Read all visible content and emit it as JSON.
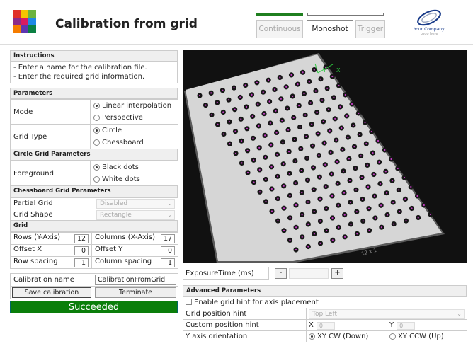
{
  "header": {
    "title": "Calibration from grid",
    "modes": [
      "Continuous",
      "Monoshot",
      "Trigger"
    ],
    "active_mode": "Monoshot",
    "company_line1": "Your Company",
    "company_line2": "Logo here",
    "colors": {
      "indicator_active": "#1f7f1f",
      "indicator_inactive": "#777777"
    }
  },
  "instructions": {
    "header": "Instructions",
    "lines": [
      "- Enter a name for the calibration file.",
      "- Enter the required grid information."
    ]
  },
  "parameters": {
    "header": "Parameters",
    "mode_label": "Mode",
    "mode_options": [
      "Linear interpolation",
      "Perspective"
    ],
    "grid_type_label": "Grid Type",
    "grid_type_options": [
      "Circle",
      "Chessboard"
    ]
  },
  "circle_grid": {
    "header": "Circle Grid Parameters",
    "foreground_label": "Foreground",
    "foreground_options": [
      "Black dots",
      "White dots"
    ]
  },
  "chessboard": {
    "header": "Chessboard Grid Parameters",
    "partial_grid_label": "Partial Grid",
    "partial_grid_value": "Disabled",
    "grid_shape_label": "Grid Shape",
    "grid_shape_value": "Rectangle"
  },
  "grid": {
    "header": "Grid",
    "rows_label": "Rows (Y-Axis)",
    "rows_value": "12",
    "cols_label": "Columns (X-Axis)",
    "cols_value": "17",
    "offset_x_label": "Offset X",
    "offset_x_value": "0",
    "offset_y_label": "Offset Y",
    "offset_y_value": "0",
    "row_spacing_label": "Row spacing",
    "row_spacing_value": "1",
    "col_spacing_label": "Column spacing",
    "col_spacing_value": "1"
  },
  "calibration": {
    "name_label": "Calibration name",
    "name_value": "CalibrationFromGrid",
    "save_label": "Save calibration",
    "terminate_label": "Terminate",
    "status": "Succeeded",
    "status_color": "#0a7e0a"
  },
  "image": {
    "axis_x": "X",
    "axis_y": "Y",
    "paper_text": "12 x 1"
  },
  "exposure": {
    "label": "ExposureTime (ms)",
    "minus": "-",
    "plus": "+"
  },
  "advanced": {
    "header": "Advanced Parameters",
    "enable_hint_label": "Enable grid hint for axis placement",
    "grid_position_label": "Grid position hint",
    "grid_position_value": "Top Left",
    "custom_position_label": "Custom position hint",
    "custom_x_label": "X",
    "custom_x_value": "0",
    "custom_y_label": "Y",
    "custom_y_value": "0",
    "y_axis_label": "Y axis orientation",
    "y_axis_options": [
      "XY CW (Down)",
      "XY CCW (Up)"
    ]
  }
}
